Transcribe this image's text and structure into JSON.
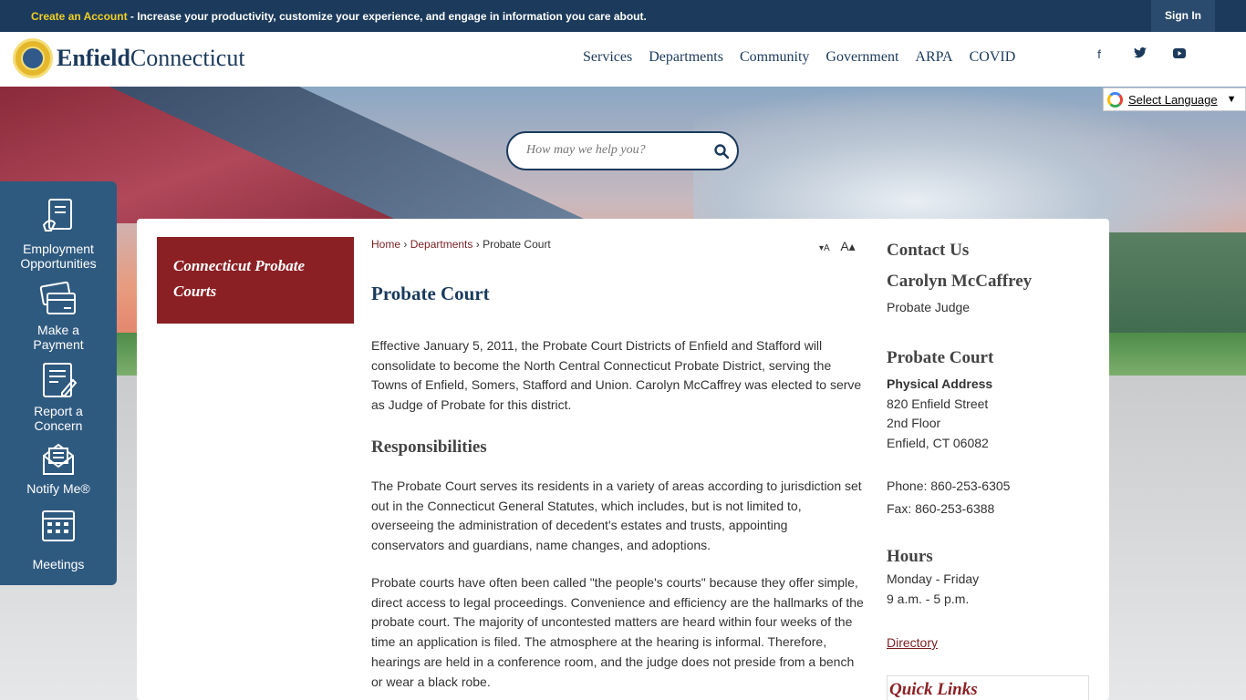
{
  "topbar": {
    "create_account": "Create an Account",
    "message": " - Increase your productivity, customize your experience, and engage in information you care about.",
    "sign_in": "Sign In"
  },
  "logo": {
    "enfield": "Enfield",
    "connecticut": "Connecticut"
  },
  "nav": [
    "Services",
    "Departments",
    "Community",
    "Government",
    "ARPA",
    "COVID"
  ],
  "social": {
    "facebook": "f",
    "twitter": "t",
    "youtube": "▶"
  },
  "translate": {
    "label": "Select Language",
    "arrow": "▼"
  },
  "search": {
    "placeholder": "How may we help you?"
  },
  "quick_sidebar": [
    {
      "line1": "Employment",
      "line2": "Opportunities",
      "icon": "form-hand-icon"
    },
    {
      "line1": "Make a",
      "line2": "Payment",
      "icon": "credit-card-icon"
    },
    {
      "line1": "Report a",
      "line2": "Concern",
      "icon": "report-icon"
    },
    {
      "line1": "Notify Me®",
      "line2": "",
      "icon": "envelope-icon"
    },
    {
      "line1": "Meetings",
      "line2": "",
      "icon": "calendar-icon"
    }
  ],
  "subnav": {
    "title": "Connecticut Probate Courts"
  },
  "breadcrumb": {
    "home": "Home",
    "sep": " › ",
    "departments": "Departments",
    "current": "Probate Court"
  },
  "font_controls": {
    "decrease": "▾A",
    "increase": "A▴"
  },
  "main": {
    "title": "Probate Court",
    "intro": "Effective January 5, 2011, the Probate Court Districts of Enfield and Stafford will consolidate to become the North Central Connecticut Probate District, serving the Towns of Enfield, Somers, Stafford and Union. Carolyn McCaffrey was elected to serve as Judge of Probate for this district.",
    "resp_heading": "Responsibilities",
    "resp_text": "The Probate Court serves its residents in a variety of areas according to jurisdiction set out in the Connecticut General Statutes, which includes, but is not limited to, overseeing the administration of decedent's estates and trusts, appointing conservators and guardians, name changes, and adoptions.",
    "peoples_text": "Probate courts have often been called \"the people's courts\" because they offer simple, direct access to legal proceedings. Convenience and efficiency are the hallmarks of the probate court. The majority of uncontested matters are heard within four weeks of the time an application is filed. The atmosphere at the hearing is informal. Therefore, hearings are held in a conference room, and the judge does not preside from a bench or wear a black robe."
  },
  "contact": {
    "heading": "Contact Us",
    "name": "Carolyn McCaffrey",
    "role": "Probate Judge",
    "office": "Probate Court",
    "addr_label": "Physical Address",
    "addr1": "820 Enfield Street",
    "addr2": "2nd Floor",
    "addr3": "Enfield, CT 06082",
    "phone": "Phone: 860-253-6305",
    "fax": "Fax: 860-253-6388",
    "hours_heading": "Hours",
    "hours1": "Monday - Friday",
    "hours2": "9 a.m. - 5 p.m.",
    "directory": "Directory",
    "quick_links": "Quick Links"
  },
  "colors": {
    "navy": "#1b3a5c",
    "maroon": "#8b2024",
    "accent_yellow": "#f2d024",
    "sidebar_blue": "#2f5a80"
  }
}
